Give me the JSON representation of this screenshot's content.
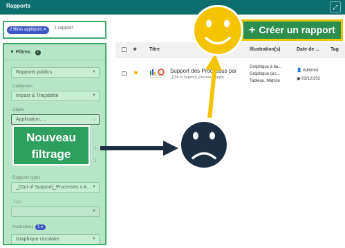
{
  "header": {
    "title": "Rapports",
    "expand_icon": "expand-icon"
  },
  "filter_bar": {
    "chip_label": "2 filtres appliqués",
    "chip_close": "✕",
    "result_count": "1 rapport"
  },
  "filters": {
    "title": "Filtres",
    "info_icon": "i",
    "scope_value": "Rapports publics",
    "categories_label": "Catégories",
    "categories_value": "Impact & Traçabilité",
    "objects_label": "Objets",
    "objects_placeholder": "Application, ...",
    "report_types_label": "Rapports types",
    "report_types_value": "_(Out of Support)_Processes x A...",
    "tags_label": "Tags",
    "illustrations_label": "Illustrations",
    "illustrations_badge": "1 ✕",
    "illustrations_value": "Graphique circulaire"
  },
  "callout": {
    "line1": "Nouveau",
    "line2": "filtrage"
  },
  "create_button": {
    "plus": "+",
    "label": "Créer un rapport"
  },
  "table": {
    "columns": [
      "Titre",
      "Illustration(s)",
      "Date de ...",
      "Tag"
    ],
    "rows": [
      {
        "title": "Support des Processus par",
        "subtitle": "_(Out of Support)_Process x Applic",
        "illustrations": [
          "Graphique à ba...",
          "Graphique circ...",
          "Tableau, Matrice"
        ],
        "author": "Administ",
        "date": "03/12/202"
      }
    ]
  },
  "colors": {
    "accent_teal": "#0e6e6e",
    "highlight_green": "#3daa6a",
    "button_green": "#2d8f4e",
    "chip_blue": "#3c58c8",
    "highlight_yellow": "#f5c400",
    "arrow_navy": "#1c2e40"
  }
}
